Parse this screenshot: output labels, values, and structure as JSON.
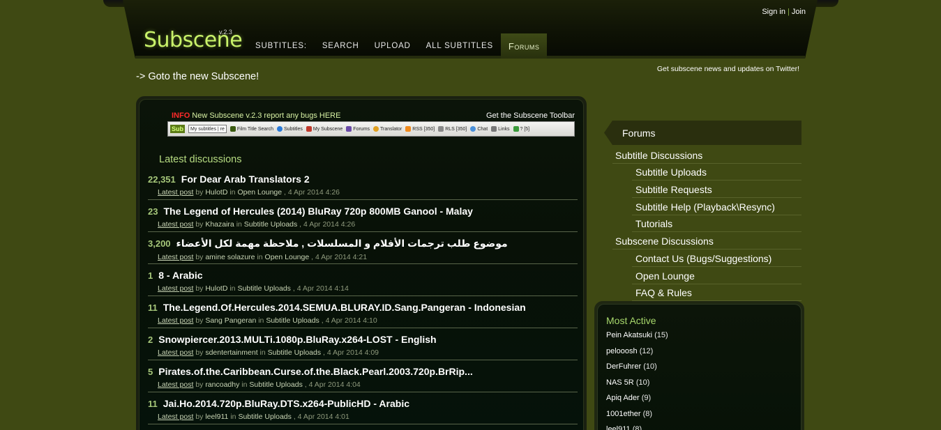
{
  "header": {
    "logo": "Subscene",
    "version": "v.2.3",
    "nav": [
      "subtitles:",
      "search",
      "upload",
      "all subtitles",
      "Forums"
    ],
    "active_nav": "Forums",
    "sign_in": "Sign in",
    "join": "Join",
    "auth_separator": "|"
  },
  "goto_new": "-> Goto the new Subscene!",
  "twitter_text": "Get subscene news and updates on Twitter!",
  "main": {
    "info_tag": "INFO",
    "info_text": "New Subscene v.2.3 report any bugs HERE",
    "toolbar_link": "Get the Subscene Toolbar",
    "toolbar_image": {
      "logo": "Sub",
      "select": "My subtitles | re",
      "items": [
        "Film Title Search",
        "Subtitles",
        "My Subscene",
        "Forums",
        "Translator",
        "RSS [350]",
        "RLS [350]",
        "Chat",
        "Links",
        "? [5]"
      ]
    },
    "latest_title": "Latest discussions",
    "latest_post_label": "Latest post",
    "by_label": "by",
    "in_label": "in",
    "discussions": [
      {
        "count": "22,351",
        "title": "For Dear Arab Translators 2",
        "user": "HulotD",
        "forum": "Open Lounge",
        "date": "4 Apr 2014 4:26"
      },
      {
        "count": "23",
        "title": "The Legend of Hercules (2014) BluRay 720p 800MB Ganool - Malay",
        "user": "Khazaira",
        "forum": "Subtitle Uploads",
        "date": "4 Apr 2014 4:26"
      },
      {
        "count": "3,200",
        "title": "موضوع طلب ترجمات الأفلام و المسلسلات , ملاحظة مهمة لكل الأعضاء",
        "user": "amine solazure",
        "forum": "Open Lounge",
        "date": "4 Apr 2014 4:21"
      },
      {
        "count": "1",
        "title": "8 - Arabic",
        "user": "HulotD",
        "forum": "Subtitle Uploads",
        "date": "4 Apr 2014 4:14"
      },
      {
        "count": "11",
        "title": "The.Legend.Of.Hercules.2014.SEMUA.BLURAY.ID.Sang.Pangeran - Indonesian",
        "user": "Sang Pangeran",
        "forum": "Subtitle Uploads",
        "date": "4 Apr 2014 4:10"
      },
      {
        "count": "2",
        "title": "Snowpiercer.2013.MULTi.1080p.BluRay.x264-LOST - English",
        "user": "sdentertainment",
        "forum": "Subtitle Uploads",
        "date": "4 Apr 2014 4:09"
      },
      {
        "count": "5",
        "title": "Pirates.of.the.Caribbean.Curse.of.the.Black.Pearl.2003.720p.BrRip...",
        "user": "rancoadhy",
        "forum": "Subtitle Uploads",
        "date": "4 Apr 2014 4:04"
      },
      {
        "count": "11",
        "title": "Jai.Ho.2014.720p.BluRay.DTS.x264-PublicHD - Arabic",
        "user": "leel911",
        "forum": "Subtitle Uploads",
        "date": "4 Apr 2014 4:01"
      }
    ]
  },
  "sidebar": {
    "forums_title": "Forums",
    "forums": [
      {
        "label": "Subtitle Discussions",
        "level": 0
      },
      {
        "label": "Subtitle Uploads",
        "level": 1
      },
      {
        "label": "Subtitle Requests",
        "level": 1
      },
      {
        "label": "Subtitle Help (Playback\\Resync)",
        "level": 1
      },
      {
        "label": "Tutorials",
        "level": 1
      },
      {
        "label": "Subscene Discussions",
        "level": 0
      },
      {
        "label": "Contact Us (Bugs/Suggestions)",
        "level": 1
      },
      {
        "label": "Open Lounge",
        "level": 1
      },
      {
        "label": "FAQ & Rules",
        "level": 1
      }
    ],
    "most_active_title": "Most Active",
    "most_active": [
      {
        "name": "Pein Akatsuki",
        "count": "(15)"
      },
      {
        "name": "pelooosh",
        "count": "(12)"
      },
      {
        "name": "DerFuhrer",
        "count": "(10)"
      },
      {
        "name": "NAS 5R",
        "count": "(10)"
      },
      {
        "name": "Apiq Ader",
        "count": "(9)"
      },
      {
        "name": "1001ether",
        "count": "(8)"
      },
      {
        "name": "leel911",
        "count": "(8)"
      }
    ]
  }
}
